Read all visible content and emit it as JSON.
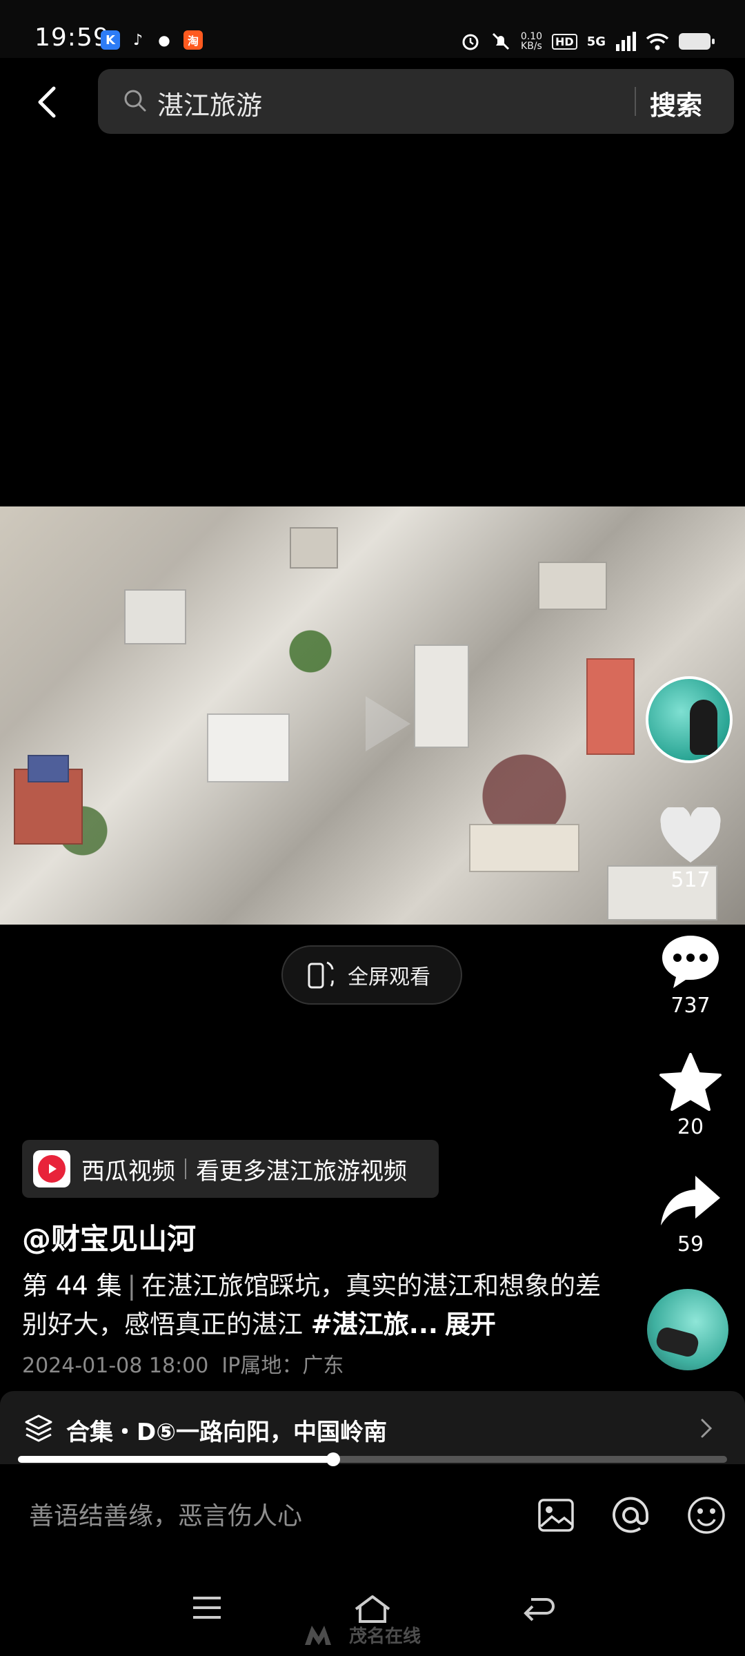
{
  "status_bar": {
    "time": "19:59",
    "network_speed": "0.10",
    "network_speed_unit": "KB/s",
    "hd": "HD",
    "network_type": "5G"
  },
  "search": {
    "query": "湛江旅游",
    "button_label": "搜索"
  },
  "video": {
    "fullscreen_label": "全屏观看",
    "progress_percent": 44.5
  },
  "actions": {
    "likes": "517",
    "comments": "737",
    "favorites": "20",
    "shares": "59"
  },
  "source": {
    "app_name": "西瓜视频",
    "more_text": "看更多湛江旅游视频"
  },
  "post": {
    "author": "@财宝见山河",
    "episode": "第 44 集",
    "description": "在湛江旅馆踩坑，真实的湛江和想象的差别好大，感悟真正的湛江",
    "hashtag": "#湛江旅...",
    "expand_label": "展开",
    "timestamp": "2024-01-08 18:00",
    "ip_location": "IP属地：广东"
  },
  "collection": {
    "label": "合集・D⑤一路向阳，中国岭南"
  },
  "comment_bar": {
    "placeholder": "善语结善缘，恶言伤人心"
  },
  "watermark": {
    "text": "茂名在线"
  }
}
